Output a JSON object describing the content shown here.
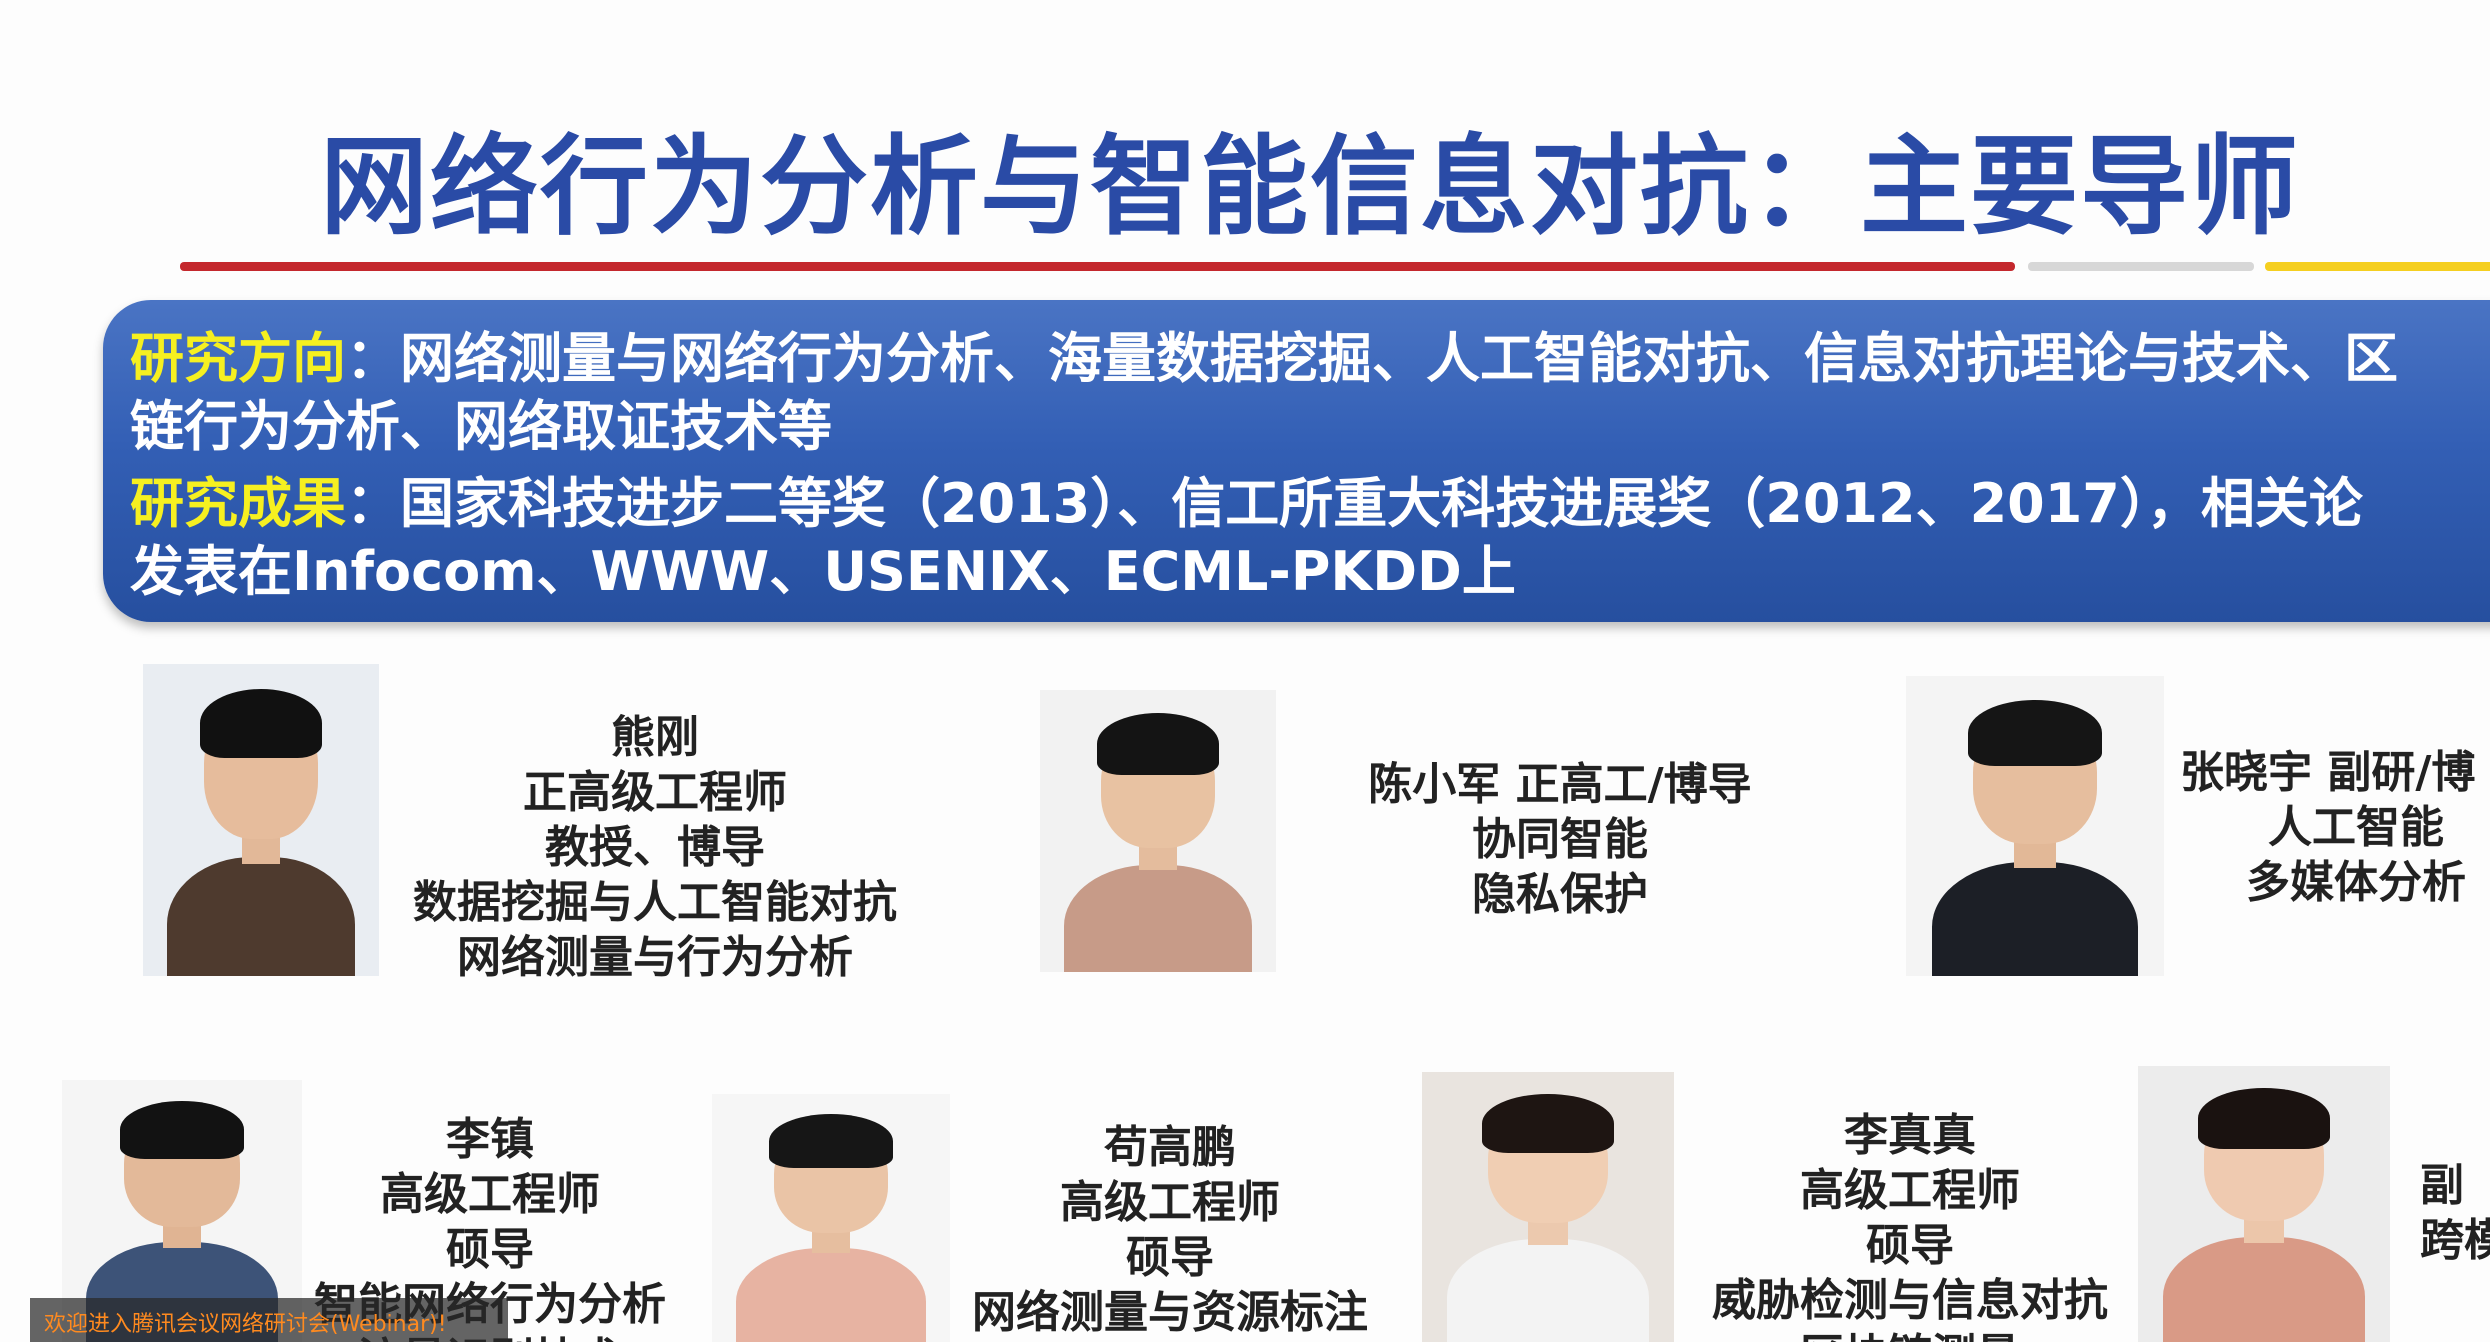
{
  "slide": {
    "title": "网络行为分析与智能信息对抗：主要导师",
    "banner": {
      "direction_key": "研究方向",
      "direction_sep": "：",
      "direction_line1": "网络测量与网络行为分析、海量数据挖掘、人工智能对抗、信息对抗理论与技术、区",
      "direction_line2": "链行为分析、网络取证技术等",
      "result_key": "研究成果",
      "result_sep": "：",
      "result_line1": "国家科技进步二等奖（2013）、信工所重大科技进展奖（2012、2017），相关论",
      "result_line2": "发表在Infocom、WWW、USENIX、ECML-PKDD上"
    },
    "mentors": [
      {
        "lines": [
          "熊刚",
          "正高级工程师",
          "教授、博导",
          "数据挖掘与人工智能对抗",
          "网络测量与行为分析"
        ]
      },
      {
        "lines": [
          "陈小军  正高工/博导",
          "协同智能",
          "隐私保护"
        ]
      },
      {
        "lines": [
          "张晓宇 副研/博",
          "人工智能",
          "多媒体分析"
        ]
      },
      {
        "lines": [
          "李镇",
          "高级工程师",
          "硕导",
          "智能网络行为分析",
          "流量识别技术"
        ]
      },
      {
        "lines": [
          "苟高鹏",
          "高级工程师",
          "硕导",
          "网络测量与资源标注"
        ]
      },
      {
        "lines": [
          "李真真",
          "高级工程师",
          "硕导",
          "威胁检测与信息对抗",
          "区块链测量"
        ]
      },
      {
        "lines": [
          "副",
          "",
          "跨模"
        ]
      }
    ]
  },
  "overlay": {
    "webinar_notice": "欢迎进入腾讯会议网络研讨会(Webinar)!"
  }
}
